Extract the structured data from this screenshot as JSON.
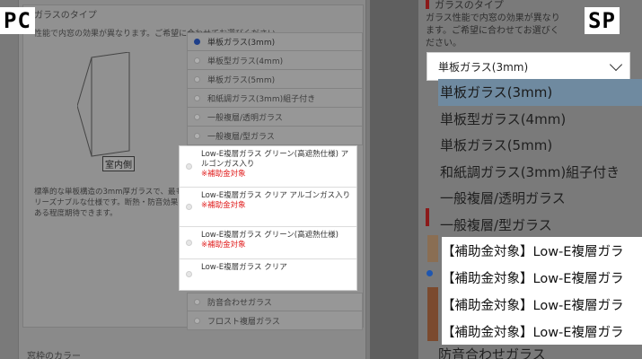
{
  "labels": {
    "pc": "PC",
    "sp": "SP"
  },
  "pc": {
    "section_title": "ガラスのタイプ",
    "description": "性能で内窓の効果が異なります。ご希望に合わせてお選びください。",
    "illustration_caption": "室内側",
    "note": "標準的な単板構造の3mm厚ガラスで、最もリーズナブルな仕様です。断熱・防音効果もある程度期待できます。",
    "options_top": [
      {
        "label": "単板ガラス(3mm)",
        "selected": true
      },
      {
        "label": "単板型ガラス(4mm)",
        "selected": false
      },
      {
        "label": "単板ガラス(5mm)",
        "selected": false
      },
      {
        "label": "和紙調ガラス(3mm)組子付き",
        "selected": false
      },
      {
        "label": "一般複層/透明ガラス",
        "selected": false
      },
      {
        "label": "一般複層/型ガラス",
        "selected": false
      }
    ],
    "highlighted_options": [
      {
        "label": "Low-E複層ガラス グリーン(高遮熱仕様) アルゴンガス入り",
        "sub": "※補助金対象"
      },
      {
        "label": "Low-E複層ガラス クリア アルゴンガス入り",
        "sub": "※補助金対象"
      },
      {
        "label": "Low-E複層ガラス グリーン(高遮熱仕様)",
        "sub": "※補助金対象"
      },
      {
        "label": "Low-E複層ガラス クリア",
        "sub": ""
      }
    ],
    "options_bottom": [
      {
        "label": "防音合わせガラス"
      },
      {
        "label": "フロスト複層ガラス"
      }
    ],
    "lower_section_title": "窓枠のカラー"
  },
  "sp": {
    "section_title": "ガラスのタイプ",
    "description": "ガラス性能で内窓の効果が異なります。ご希望に合わせてお選びください。",
    "select_value": "単板ガラス(3mm)",
    "dropdown_options": [
      {
        "label": "単板ガラス(3mm)",
        "selected": true
      },
      {
        "label": "単板型ガラス(4mm)",
        "selected": false
      },
      {
        "label": "単板ガラス(5mm)",
        "selected": false
      },
      {
        "label": "和紙調ガラス(3mm)組子付き",
        "selected": false
      },
      {
        "label": "一般複層/透明ガラス",
        "selected": false
      },
      {
        "label": "一般複層/型ガラス",
        "selected": false
      }
    ],
    "highlighted_options": [
      "【補助金対象】Low-E複層ガラ",
      "【補助金対象】Low-E複層ガラ",
      "【補助金対象】Low-E複層ガラ",
      "【補助金対象】Low-E複層ガラ"
    ],
    "tail_option": "防音合わせガラス"
  },
  "colors": {
    "selected_radio": "#1e3f8a",
    "subsidy_red": "#e01e1e",
    "sp_selected": "#6f8aa0"
  }
}
